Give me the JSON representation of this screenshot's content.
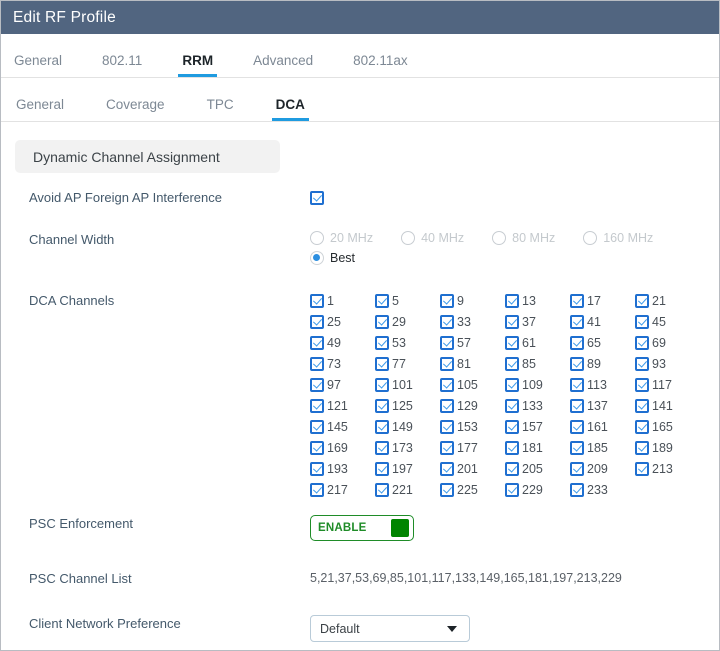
{
  "window": {
    "title": "Edit RF Profile"
  },
  "primary_tabs": [
    {
      "label": "General",
      "active": false
    },
    {
      "label": "802.11",
      "active": false
    },
    {
      "label": "RRM",
      "active": true
    },
    {
      "label": "Advanced",
      "active": false
    },
    {
      "label": "802.11ax",
      "active": false
    }
  ],
  "secondary_tabs": [
    {
      "label": "General",
      "active": false
    },
    {
      "label": "Coverage",
      "active": false
    },
    {
      "label": "TPC",
      "active": false
    },
    {
      "label": "DCA",
      "active": true
    }
  ],
  "section": {
    "header": "Dynamic Channel Assignment"
  },
  "fields": {
    "avoid_interference": {
      "label": "Avoid AP Foreign AP Interference",
      "checked": true
    },
    "channel_width": {
      "label": "Channel Width",
      "options": [
        {
          "label": "20 MHz",
          "selected": false
        },
        {
          "label": "40 MHz",
          "selected": false
        },
        {
          "label": "80 MHz",
          "selected": false
        },
        {
          "label": "160 MHz",
          "selected": false
        },
        {
          "label": "Best",
          "selected": true
        }
      ]
    },
    "dca_channels": {
      "label": "DCA Channels",
      "channels": [
        "1",
        "5",
        "9",
        "13",
        "17",
        "21",
        "25",
        "29",
        "33",
        "37",
        "41",
        "45",
        "49",
        "53",
        "57",
        "61",
        "65",
        "69",
        "73",
        "77",
        "81",
        "85",
        "89",
        "93",
        "97",
        "101",
        "105",
        "109",
        "113",
        "117",
        "121",
        "125",
        "129",
        "133",
        "137",
        "141",
        "145",
        "149",
        "153",
        "157",
        "161",
        "165",
        "169",
        "173",
        "177",
        "181",
        "185",
        "189",
        "193",
        "197",
        "201",
        "205",
        "209",
        "213",
        "217",
        "221",
        "225",
        "229",
        "233"
      ],
      "all_checked": true
    },
    "psc_enforcement": {
      "label": "PSC Enforcement",
      "toggle_text": "ENABLE",
      "state": "on"
    },
    "psc_channel_list": {
      "label": "PSC Channel List",
      "value": "5,21,37,53,69,85,101,117,133,149,165,181,197,213,229"
    },
    "client_network_preference": {
      "label": "Client Network Preference",
      "value": "Default"
    }
  },
  "colors": {
    "titlebar": "#516580",
    "accent_blue": "#1f9be0",
    "checkbox_blue": "#1f6fd0",
    "toggle_green": "#1f8c28",
    "label_slate": "#44596b"
  }
}
